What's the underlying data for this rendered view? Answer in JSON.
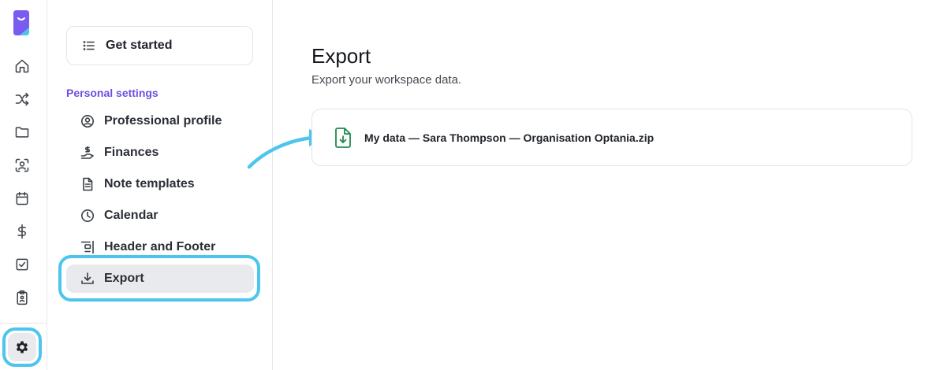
{
  "rail": {
    "logo": "app-logo",
    "icons": [
      "home-icon",
      "shuffle-icon",
      "folder-icon",
      "scan-face-icon",
      "calendar-icon",
      "dollar-icon",
      "checkbox-icon",
      "clipboard-icon"
    ],
    "settings_icon": "gear-icon"
  },
  "sidebar": {
    "get_started": "Get started",
    "section_label": "Personal settings",
    "items": [
      {
        "label": "Professional profile",
        "icon": "user-circle-icon"
      },
      {
        "label": "Finances",
        "icon": "hand-coin-icon"
      },
      {
        "label": "Note templates",
        "icon": "document-icon"
      },
      {
        "label": "Calendar",
        "icon": "clock-icon"
      },
      {
        "label": "Header and Footer",
        "icon": "layout-icon"
      },
      {
        "label": "Export",
        "icon": "download-icon",
        "active": true
      }
    ]
  },
  "main": {
    "title": "Export",
    "subtitle": "Export your workspace data.",
    "file": {
      "name": "My data — Sara Thompson — Organisation Optania.zip",
      "icon": "file-download-icon"
    }
  },
  "colors": {
    "highlight": "#4cc6ec",
    "accent": "#6d4fe0",
    "file_icon": "#1f8a4c",
    "logo": "#7b5cf0"
  }
}
